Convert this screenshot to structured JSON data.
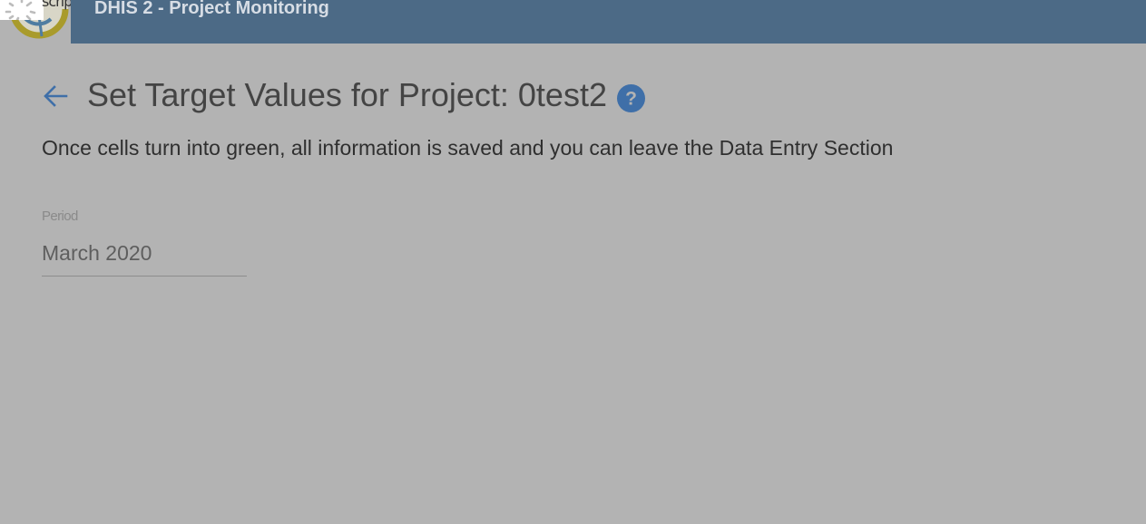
{
  "header": {
    "app_title": "DHIS 2 - Project Monitoring",
    "logo_alt_text": "scripts"
  },
  "page": {
    "title": "Set Target Values for Project: 0test2",
    "info_text": "Once cells turn into green, all information is saved and you can leave the Data Entry Section"
  },
  "period": {
    "label": "Period",
    "value": "March 2020"
  },
  "colors": {
    "header_bg": "#4c6a86",
    "page_bg": "#b3b3b3",
    "accent": "#3f6fa8"
  },
  "icons": {
    "back": "arrow-left-icon",
    "help": "help-circle-icon",
    "logo": "dhis2-logo-icon",
    "loading": "loading-spinner-icon"
  }
}
